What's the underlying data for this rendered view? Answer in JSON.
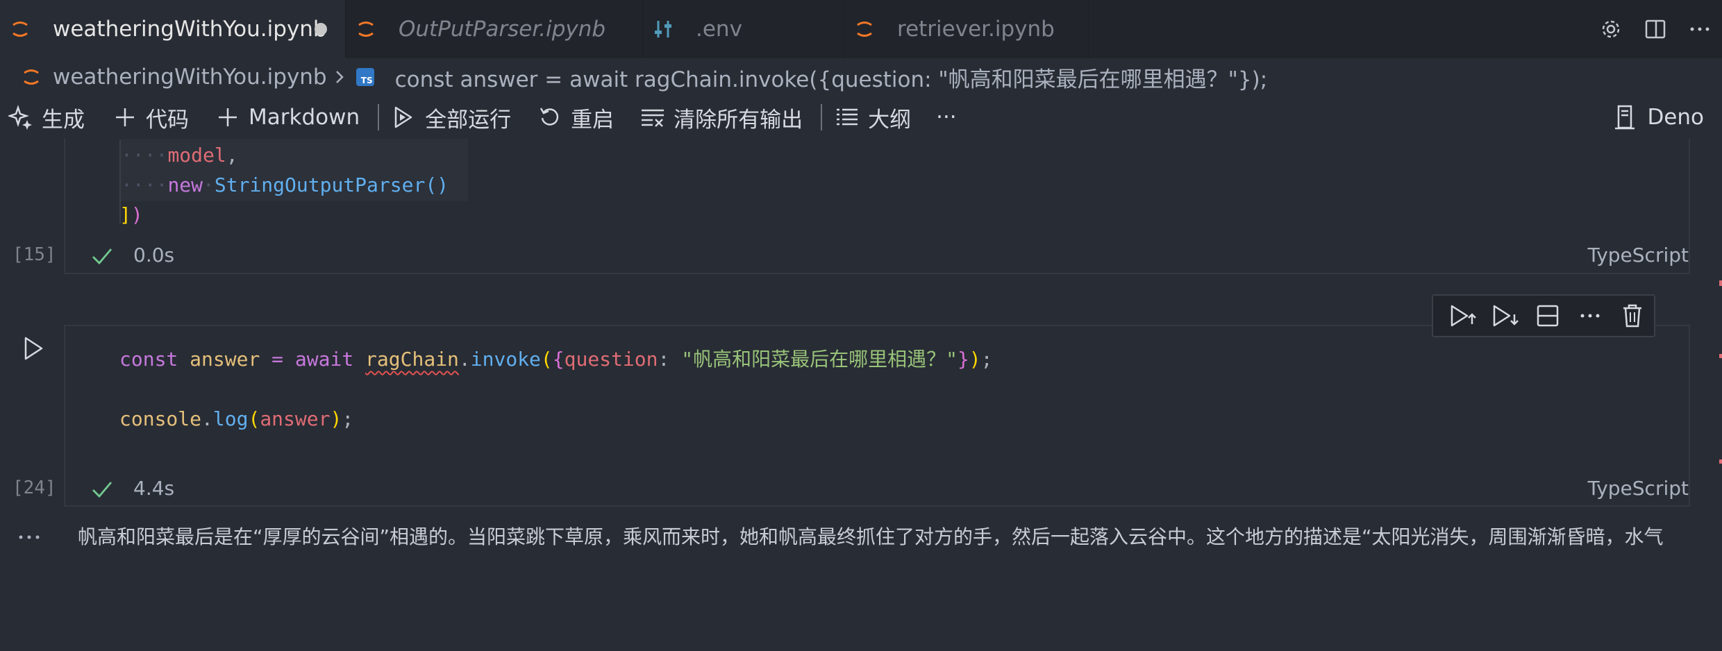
{
  "tabs": [
    {
      "label": "weatheringWithYou.ipynb",
      "active": true,
      "dirty": true,
      "icon": "jupyter-icon"
    },
    {
      "label": "OutPutParser.ipynb",
      "active": false,
      "italic": true,
      "icon": "jupyter-icon"
    },
    {
      "label": ".env",
      "active": false,
      "icon": "settings-sliders-icon"
    },
    {
      "label": "retriever.ipynb",
      "active": false,
      "icon": "jupyter-icon"
    }
  ],
  "tab_actions": [
    "gear-icon",
    "split-editor-icon",
    "more-icon"
  ],
  "breadcrumb": {
    "file": "weatheringWithYou.ipynb",
    "symbol_badge": "TS",
    "symbol": "const answer = await ragChain.invoke({question: \"帆高和阳菜最后在哪里相遇？\"});"
  },
  "toolbar": {
    "generate": "生成",
    "code": "代码",
    "markdown": "Markdown",
    "run_all": "全部运行",
    "restart": "重启",
    "clear_outputs": "清除所有输出",
    "outline": "大纲",
    "more": "···",
    "kernel": "Deno"
  },
  "cell1": {
    "code_lines": {
      "l1_dots": "····",
      "l1_tok1": "model",
      "l1_tok2": ",",
      "l2_dots": "····",
      "l2_tok1": "new",
      "l2_sp": "·",
      "l2_tok2": "StringOutputParser",
      "l2_tok3": "()",
      "l3_tok1": "]",
      "l3_tok2": ")"
    },
    "exec_count": "[15]",
    "time": "0.0s",
    "language": "TypeScript"
  },
  "cell2": {
    "line1": {
      "kw": "const",
      "name": "answer",
      "eq": "=",
      "await": "await",
      "obj": "ragChain",
      "dot": ".",
      "method": "invoke",
      "open_paren": "(",
      "open_brace": "{",
      "key": "question",
      "colon": ":",
      "value": "\"帆高和阳菜最后在哪里相遇？\"",
      "close_brace": "}",
      "close_paren": ")",
      "semi": ";"
    },
    "line2": {
      "obj": "console",
      "dot": ".",
      "method": "log",
      "open_paren": "(",
      "arg": "answer",
      "close_paren": ")",
      "semi": ";"
    },
    "exec_count": "[24]",
    "time": "4.4s",
    "language": "TypeScript"
  },
  "cell_toolbar": [
    "run-above-icon",
    "run-below-icon",
    "split-cell-icon",
    "more-icon",
    "trash-icon"
  ],
  "output": {
    "more": "···",
    "text": "帆高和阳菜最后是在“厚厚的云谷间”相遇的。当阳菜跳下草原，乘风而来时，她和帆高最终抓住了对方的手，然后一起落入云谷中。这个地方的描述是“太阳光消失，周围渐渐昏暗，水气"
  },
  "colors": {
    "background": "#282c34",
    "tabbar": "#21252b",
    "keyword": "#c678dd",
    "variable": "#e06c75",
    "function": "#61afef",
    "class": "#e5c07b",
    "string": "#98c379",
    "success": "#73c991"
  }
}
